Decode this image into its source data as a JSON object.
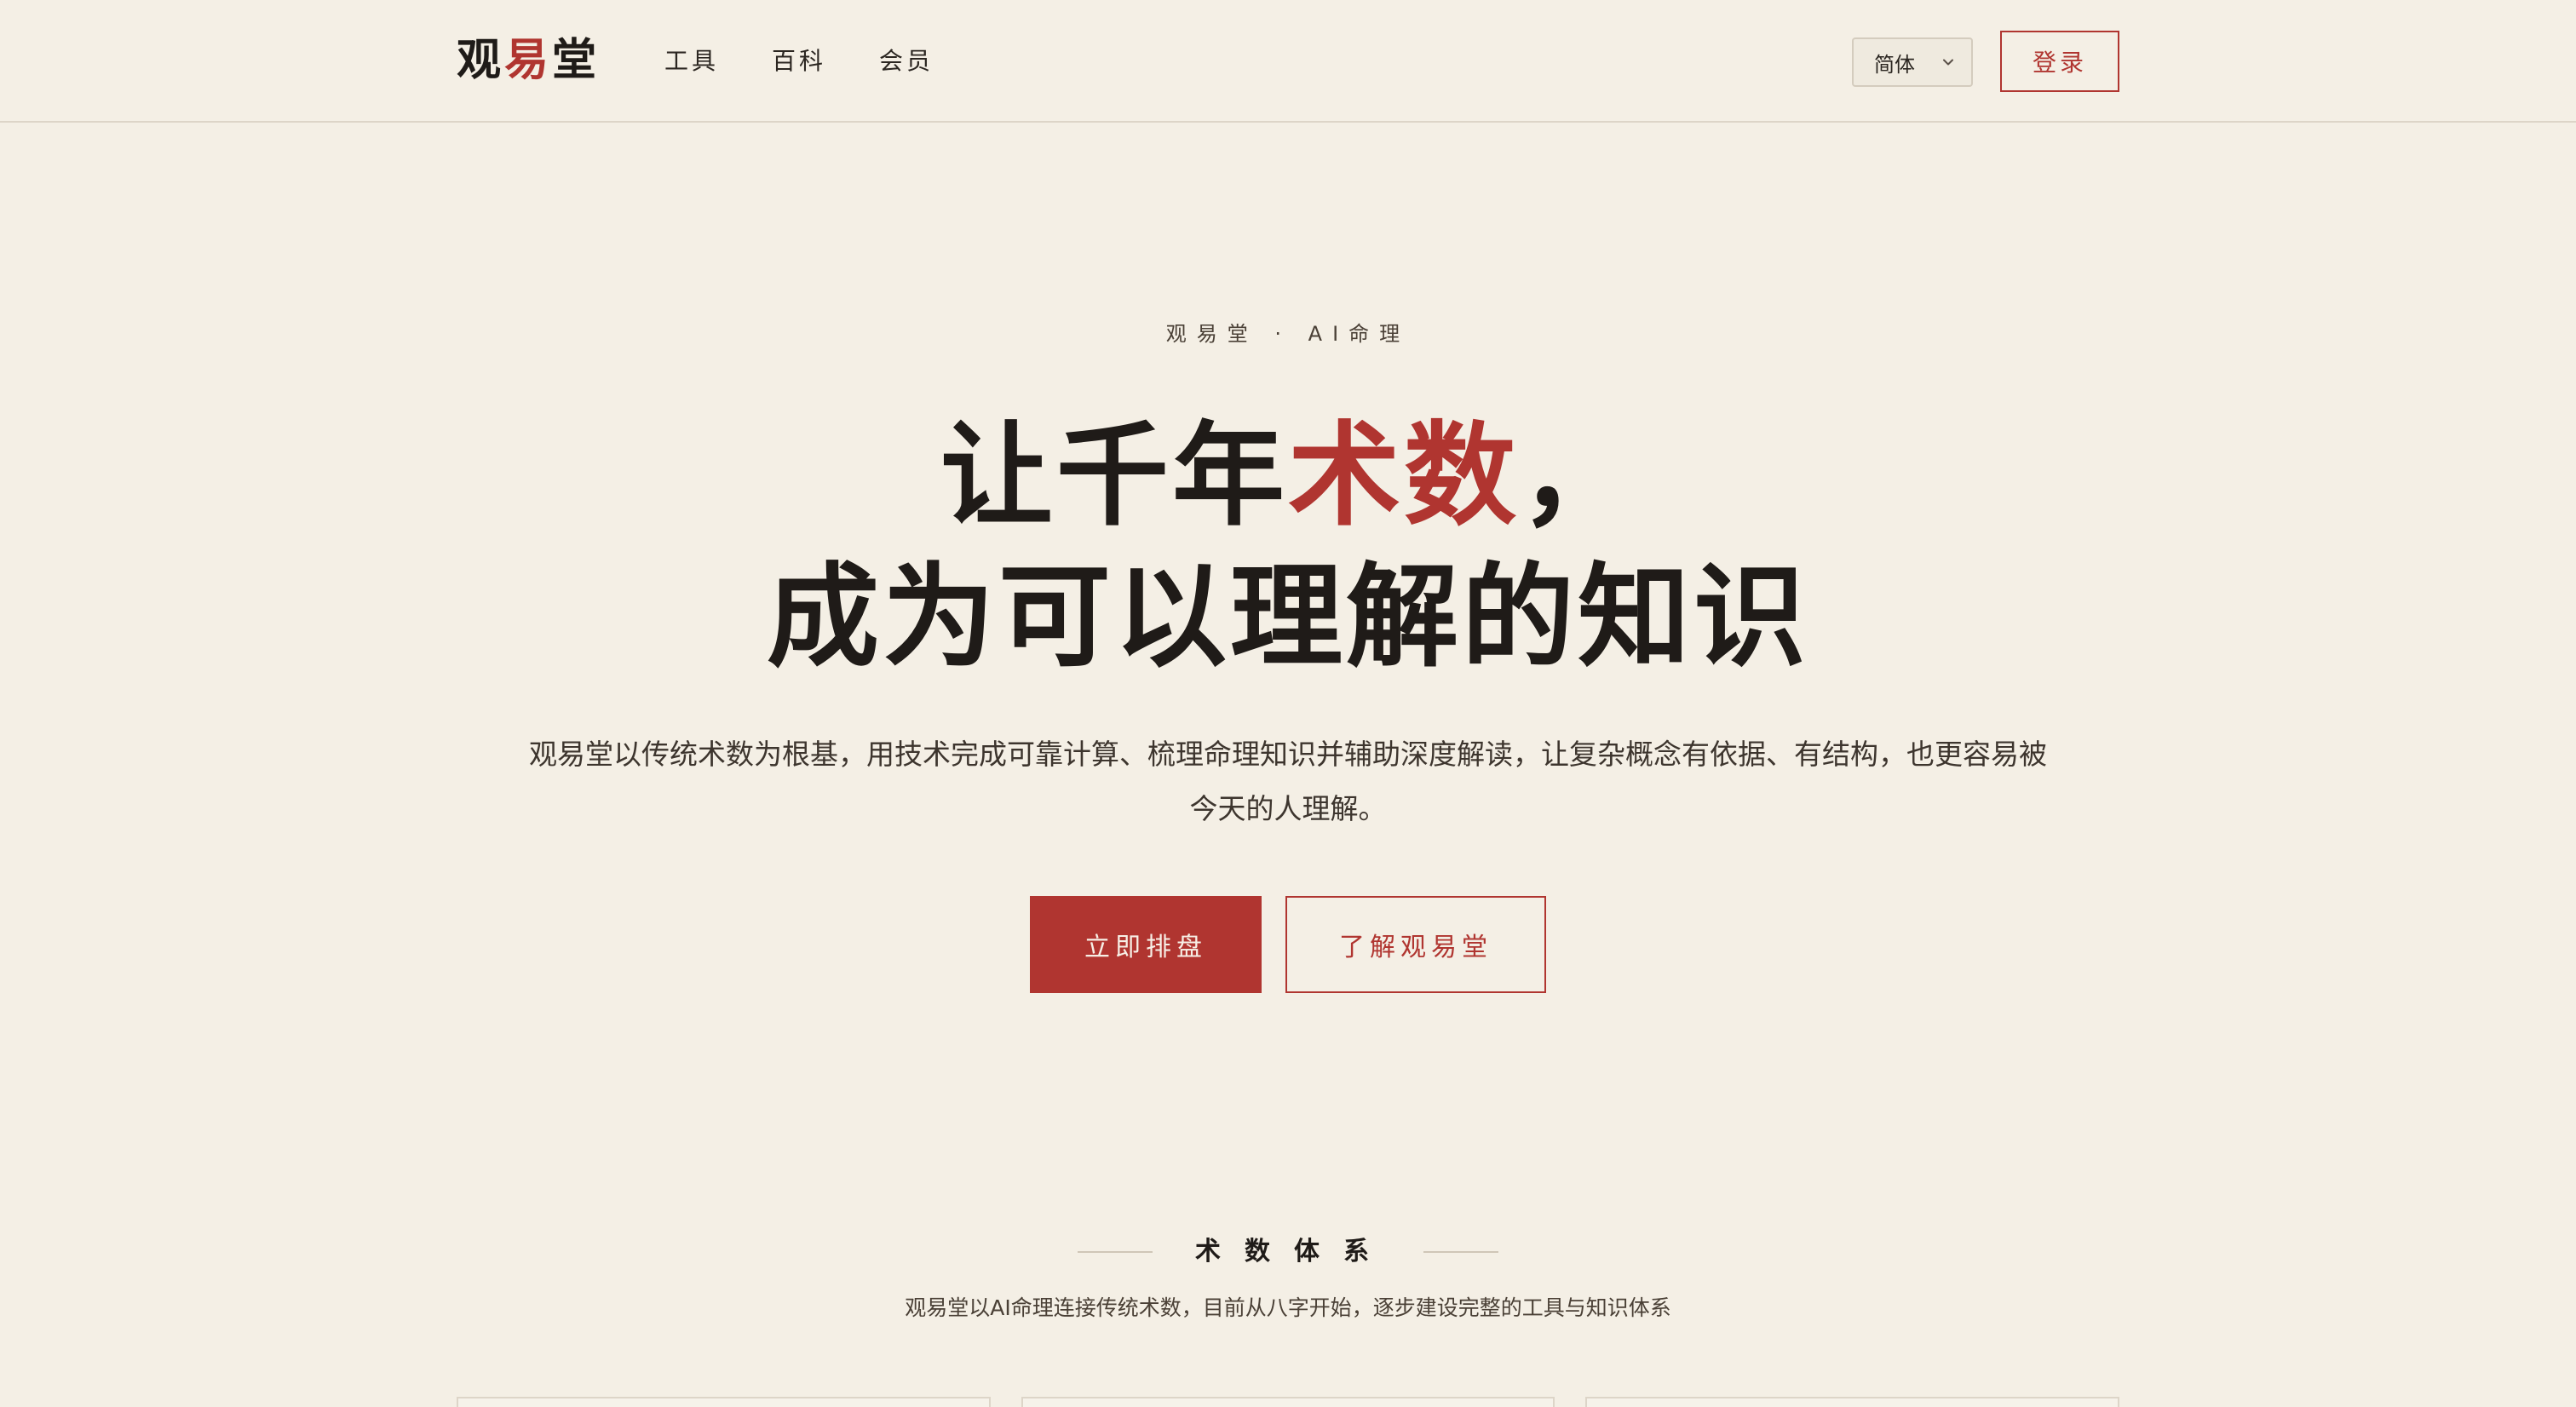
{
  "header": {
    "logo": {
      "part1": "观",
      "part2": "易",
      "part3": "堂"
    },
    "nav": [
      "工具",
      "百科",
      "会员"
    ],
    "language": {
      "value": "简体"
    },
    "login_label": "登录"
  },
  "hero": {
    "eyebrow": "观易堂 · AI命理",
    "headline": {
      "line1_prefix": "让千年",
      "line1_highlight": "术数",
      "line1_suffix": "，",
      "line2": "成为可以理解的知识"
    },
    "subtitle": "观易堂以传统术数为根基，用技术完成可靠计算、梳理命理知识并辅助深度解读，让复杂概念有依据、有结构，也更容易被今天的人理解。",
    "cta_primary": "立即排盘",
    "cta_secondary": "了解观易堂"
  },
  "section": {
    "title": "术数体系",
    "description": "观易堂以AI命理连接传统术数，目前从八字开始，逐步建设完整的工具与知识体系"
  },
  "colors": {
    "background": "#F4EFE5",
    "accent": "#B03530",
    "text": "#1F1B18"
  },
  "icons": {
    "language_chevron": "chevron-down-icon"
  }
}
